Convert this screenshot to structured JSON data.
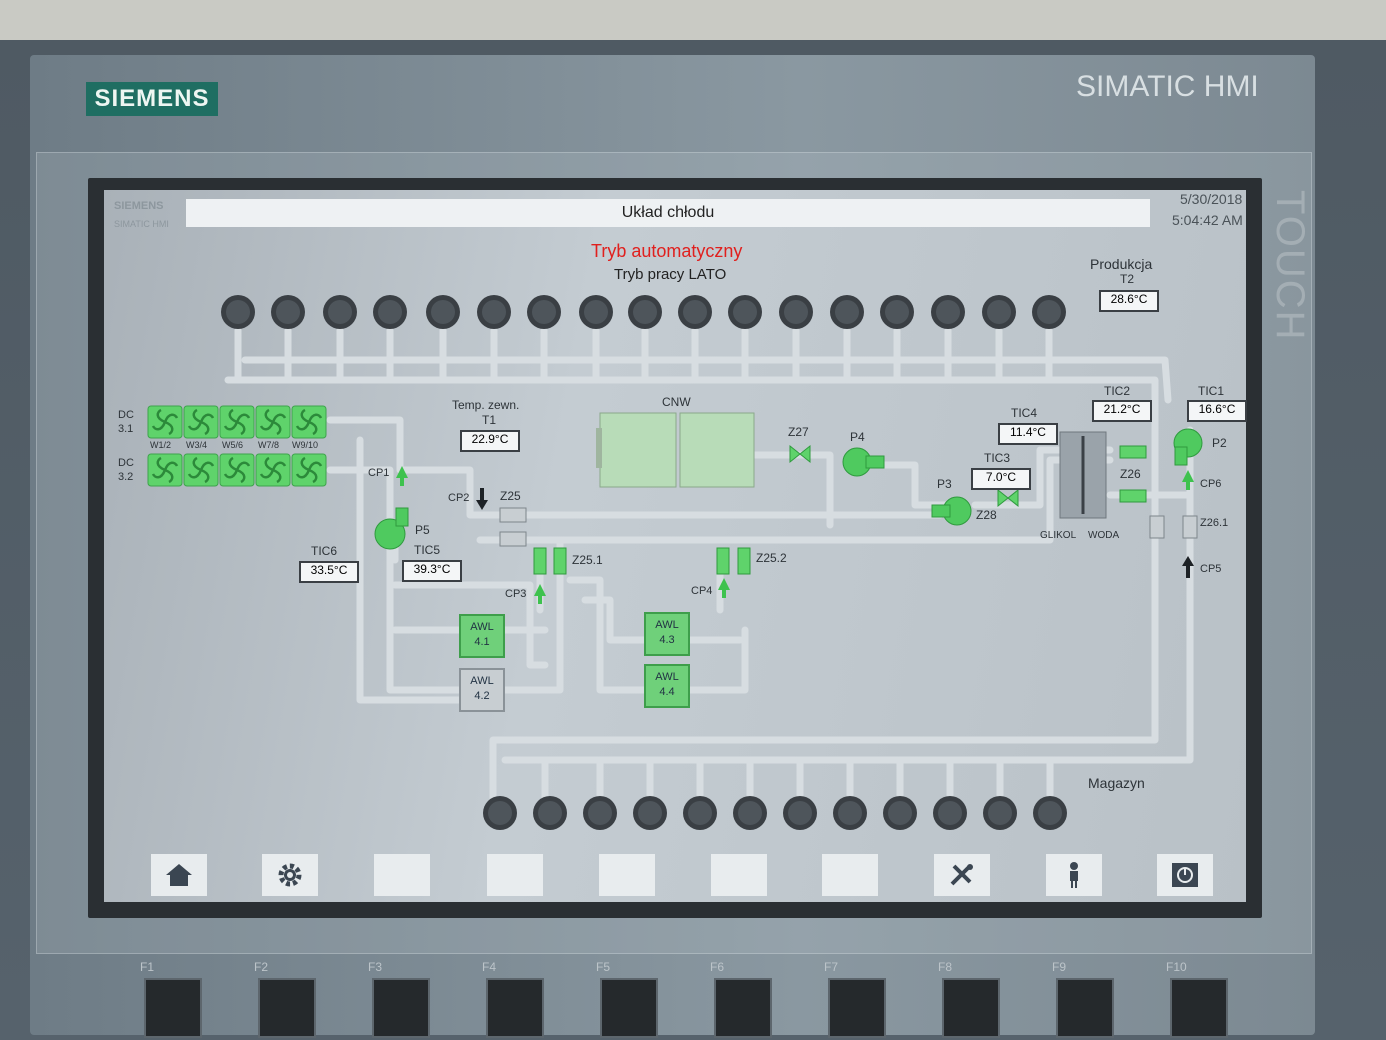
{
  "device": {
    "logo": "SIEMENS",
    "brand": "SIMATIC HMI",
    "touch_label": "TOUCH",
    "mini_logo": "SIEMENS",
    "mini_brand": "SIMATIC HMI"
  },
  "header": {
    "title": "Układ chłodu",
    "date": "5/30/2018",
    "time": "5:04:42 AM"
  },
  "status": {
    "mode": "Tryb automatyczny",
    "work_mode": "Tryb pracy LATO",
    "mode_color": "#e0201e"
  },
  "colors": {
    "green": "#5fd36b",
    "pipe": "#d7dde1",
    "fan": "#3a3f44"
  },
  "labels": {
    "produkcja": "Produkcja",
    "t2": "T2",
    "magazyn": "Magazyn",
    "temp_zewn": "Temp. zewn.",
    "t1": "T1",
    "cnw": "CNW",
    "dc31": "DC 3.1",
    "dc32": "DC 3.2",
    "w12": "W1/2",
    "w34": "W3/4",
    "w56": "W5/6",
    "w78": "W7/8",
    "w910": "W9/10",
    "cp1": "CP1",
    "cp2": "CP2",
    "cp3": "CP3",
    "cp4": "CP4",
    "cp5": "CP5",
    "cp6": "CP6",
    "p2": "P2",
    "p3": "P3",
    "p4": "P4",
    "p5": "P5",
    "z25": "Z25",
    "z251": "Z25.1",
    "z252": "Z25.2",
    "z26": "Z26",
    "z261": "Z26.1",
    "z27": "Z27",
    "z28": "Z28",
    "tic1": "TIC1",
    "tic2": "TIC2",
    "tic3": "TIC3",
    "tic4": "TIC4",
    "tic5": "TIC5",
    "tic6": "TIC6",
    "glikol": "GLIKOL",
    "woda": "WODA"
  },
  "values": {
    "t2": "28.6°C",
    "t1": "22.9°C",
    "tic1": "16.6°C",
    "tic2": "21.2°C",
    "tic3": "7.0°C",
    "tic4": "11.4°C",
    "tic5": "39.3°C",
    "tic6": "33.5°C"
  },
  "awl": [
    {
      "name": "AWL",
      "num": "4.1",
      "active": true
    },
    {
      "name": "AWL",
      "num": "4.2",
      "active": false
    },
    {
      "name": "AWL",
      "num": "4.3",
      "active": true
    },
    {
      "name": "AWL",
      "num": "4.4",
      "active": true
    }
  ],
  "nav_buttons": [
    "home-icon",
    "gear-icon",
    "",
    "",
    "",
    "",
    "",
    "tools-icon",
    "user-icon",
    "power-icon"
  ],
  "function_keys": [
    "F1",
    "F2",
    "F3",
    "F4",
    "F5",
    "F6",
    "F7",
    "F8",
    "F9",
    "F10"
  ]
}
